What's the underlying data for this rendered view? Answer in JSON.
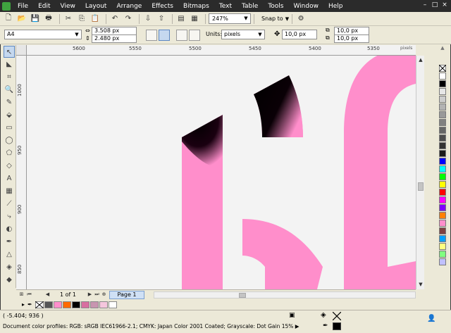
{
  "menu": [
    "File",
    "Edit",
    "View",
    "Layout",
    "Arrange",
    "Effects",
    "Bitmaps",
    "Text",
    "Table",
    "Tools",
    "Window",
    "Help"
  ],
  "window_controls": [
    "–",
    "□",
    "×"
  ],
  "toolbar": {
    "zoom": "247%",
    "snap_to": "Snap to"
  },
  "property_bar": {
    "page_size": "A4",
    "width": "3.508 px",
    "height": "2.480 px",
    "units_label": "Units:",
    "units": "pixels",
    "nudge": "10,0 px",
    "duplicate_x": "10,0 px",
    "duplicate_y": "10,0 px"
  },
  "ruler": {
    "h_labels": [
      "5600",
      "5550",
      "5500",
      "5450",
      "5400",
      "5350"
    ],
    "v_labels": [
      "1000",
      "950",
      "900",
      "850"
    ],
    "units": "pixels"
  },
  "page_nav": {
    "count": "1 of 1",
    "tab": "Page 1"
  },
  "status": {
    "coords": "( -5.404; 936  )",
    "profiles": "Document color profiles: RGB: sRGB IEC61966-2.1; CMYK: Japan Color 2001 Coated; Grayscale: Dot Gain 15% ▶"
  },
  "colors": {
    "shape_pink": "#ff8ecb",
    "canvas": "#f3f3f3",
    "palette": [
      "#ffffff",
      "#000000",
      "#e6e6e6",
      "#cccccc",
      "#b3b3b3",
      "#999999",
      "#808080",
      "#666666",
      "#4d4d4d",
      "#333333",
      "#1a1a1a",
      "#0000ff",
      "#00ffff",
      "#00ff00",
      "#ffff00",
      "#ff0000",
      "#ff00ff",
      "#8000ff",
      "#ff8000",
      "#ff8ecb",
      "#804040",
      "#00a0ff",
      "#ffff80",
      "#80ff80",
      "#c0c0ff"
    ],
    "doc_palette": [
      "#555555",
      "#ff8ecb",
      "#ff6a00",
      "#000000",
      "#d86fa0",
      "#c895b0",
      "#f5c6dd",
      "#ffffff"
    ]
  }
}
